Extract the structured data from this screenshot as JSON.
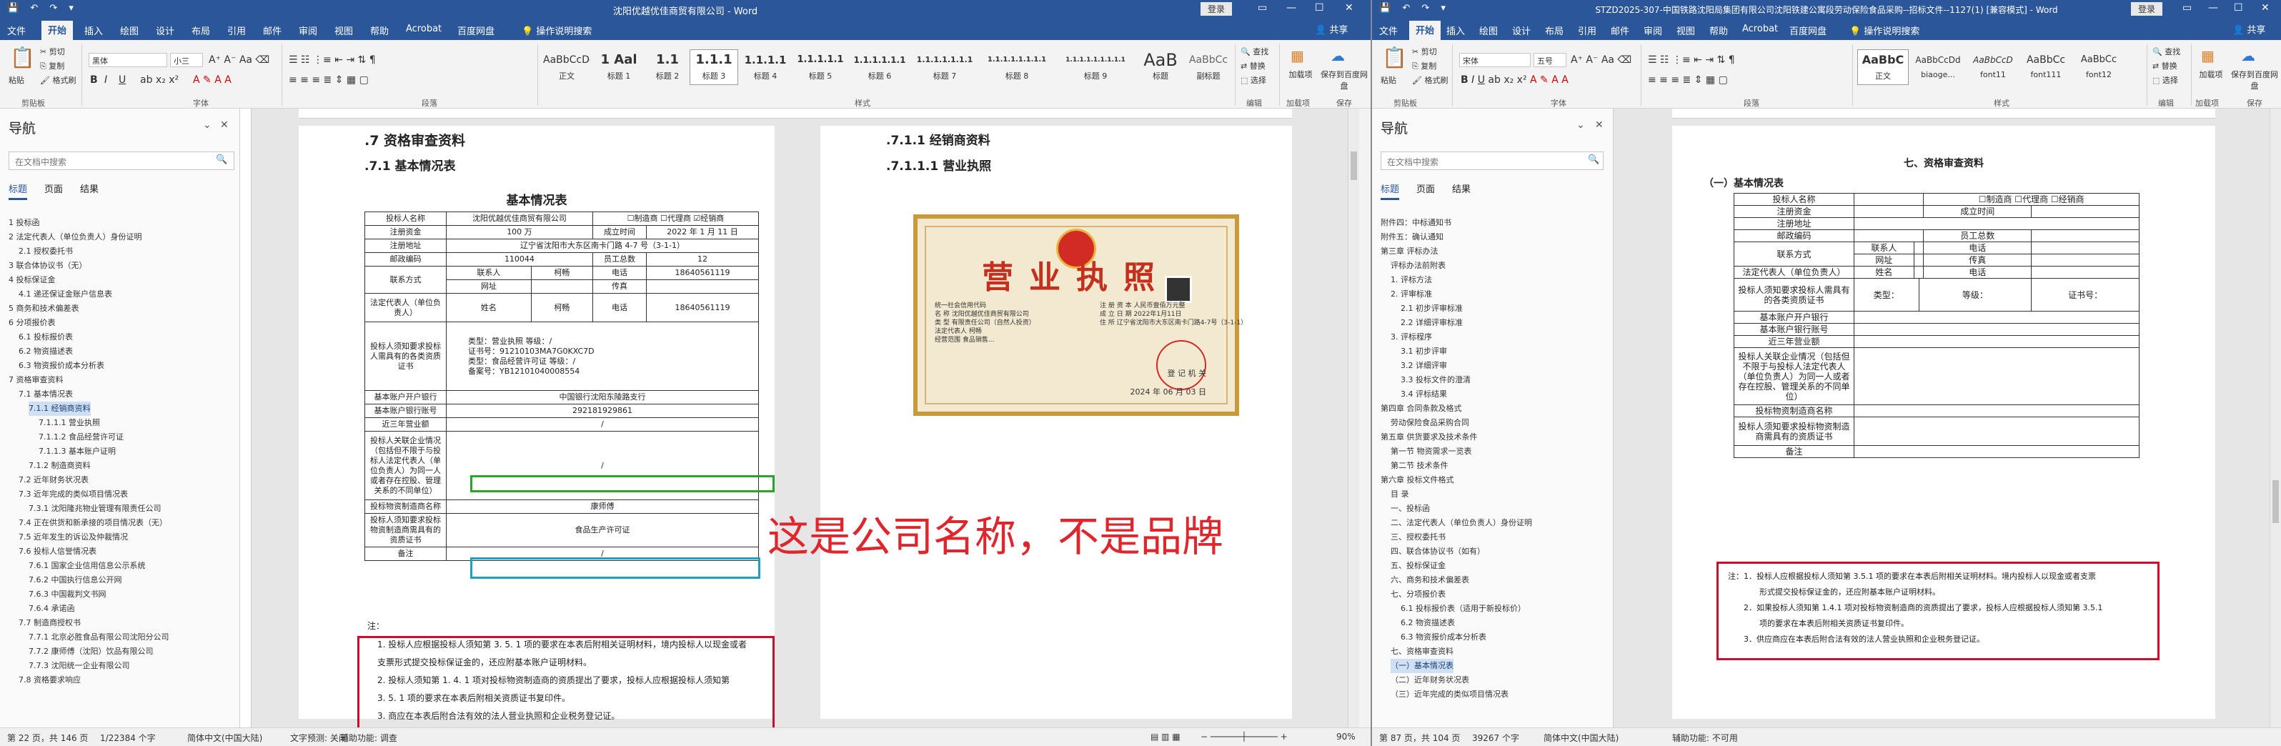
{
  "left": {
    "title": "沈阳优越优佳商贸有限公司 - Word",
    "signin": "登录",
    "share": "共享",
    "tabs": [
      "文件",
      "开始",
      "插入",
      "绘图",
      "设计",
      "布局",
      "引用",
      "邮件",
      "审阅",
      "视图",
      "帮助",
      "Acrobat",
      "百度网盘",
      "操作说明搜索"
    ],
    "ribbon": {
      "clipboard": {
        "paste": "粘贴",
        "cut": "剪切",
        "copy": "复制",
        "format": "格式刷",
        "group": "剪贴板"
      },
      "font": {
        "name": "黑体",
        "size": "小三",
        "group": "字体"
      },
      "paragraph_group": "段落",
      "styles_group": "样式",
      "styles": [
        {
          "preview": "AaBbCcDc",
          "label": "正文"
        },
        {
          "preview": "1 Aal",
          "label": "标题 1"
        },
        {
          "preview": "1.1",
          "label": "标题 2"
        },
        {
          "preview": "1.1.1",
          "label": "标题 3"
        },
        {
          "preview": "1.1.1.1",
          "label": "标题 4"
        },
        {
          "preview": "1.1.1.1.1",
          "label": "标题 5"
        },
        {
          "preview": "1.1.1.1.1.1",
          "label": "标题 6"
        },
        {
          "preview": "1.1.1.1.1.1.1",
          "label": "标题 7"
        },
        {
          "preview": "1.1.1.1.1.1.1.1",
          "label": "标题 8"
        },
        {
          "preview": "1.1.1.1.1.1.1.1.1",
          "label": "标题 9"
        },
        {
          "preview": "AaB",
          "label": "标题"
        },
        {
          "preview": "AaBbCc",
          "label": "副标题"
        }
      ],
      "editing": {
        "find": "查找",
        "replace": "替换",
        "select": "选择",
        "group": "编辑"
      },
      "addins": {
        "label": "加载项",
        "group": "加载项"
      },
      "baidu": {
        "label": "保存到百度网盘",
        "group": "保存"
      }
    },
    "nav": {
      "title": "导航",
      "search_placeholder": "在文档中搜索",
      "tabs": [
        "标题",
        "页面",
        "结果"
      ],
      "items": [
        "1 投标函",
        "2 法定代表人（单位负责人）身份证明",
        "2.1 授权委托书",
        "3 联合体协议书（无）",
        "4 投标保证金",
        "4.1 递还保证金账户信息表",
        "5 商务和技术偏差表",
        "6 分项报价表",
        "6.1 投标报价表",
        "6.2 物资描述表",
        "6.3 物资报价成本分析表",
        "7 资格审查资料",
        "7.1 基本情况表",
        "7.1.1 经销商资料",
        "7.1.1.1 营业执照",
        "7.1.1.2 食品经营许可证",
        "7.1.1.3 基本账户证明",
        "7.1.2 制造商资料",
        "7.2 近年财务状况表",
        "7.3 近年完成的类似项目情况表",
        "7.3.1 沈阳隆兆物业管理有限责任公司",
        "7.4 正在供货和新承接的项目情况表（无）",
        "7.5 近年发生的诉讼及仲裁情况",
        "7.6 投标人信誉情况表",
        "7.6.1 国家企业信用信息公示系统",
        "7.6.2 中国执行信息公开网",
        "7.6.3 中国裁判文书网",
        "7.6.4 承诺函",
        "7.7 制造商授权书",
        "7.7.1 北京必胜食品有限公司沈阳分公司",
        "7.7.2 康师傅（沈阳）饮品有限公司",
        "7.7.3 沈阳统一企业有限公司",
        "7.8 资格要求响应"
      ]
    },
    "page1": {
      "h7": ".7  资格审查资料",
      "h71": ".7.1  基本情况表",
      "table_title": "基本情况表",
      "t": {
        "name_lbl": "投标人名称",
        "name": "沈阳优越优佳商贸有限公司",
        "checks": "☐制造商  ☐代理商  ☑经销商",
        "reg_lbl": "注册资金",
        "reg": "100 万",
        "date_lbl": "成立时间",
        "date": "2022 年 1 月 11 日",
        "addr_lbl": "注册地址",
        "addr": "辽宁省沈阳市大东区南卡门路 4-7 号（3-1-1）",
        "zip_lbl": "邮政编码",
        "zip": "110044",
        "staff_lbl": "员工总数",
        "staff": "12",
        "contact_lbl": "联系方式",
        "c1": "联系人",
        "c1v": "柯畅",
        "c2": "电话",
        "c2v": "18640561119",
        "web": "网址",
        "fax": "传真",
        "legal_lbl": "法定代表人（单位负责人）",
        "ln": "姓名",
        "lnv": "柯畅",
        "lt": "电话",
        "ltv": "18640561119",
        "qual_lbl": "投标人须知要求投标人需具有的各类资质证书",
        "qual": "类型：营业执照    等级：/\n证书号：91210103MA7G0KXC7D\n类型：食品经营许可证  等级：/\n备案号：YB12101040008554",
        "bank_lbl": "基本账户开户银行",
        "bank": "中国银行沈阳东陵路支行",
        "acct_lbl": "基本账户银行账号",
        "acct": "292181929861",
        "sales_lbl": "近三年营业额",
        "related_lbl": "投标人关联企业情况（包括但不限于与投标人法定代表人（单位负责人）为同一人或者存在控股、管理关系的不同单位）",
        "brand_lbl": "投标物资制造商名称",
        "brand": "康师傅",
        "mfr_lbl": "投标人须知要求投标物资制造商需具有的资质证书",
        "mfr": "食品生产许可证",
        "remark_lbl": "备注",
        "slash": "/"
      },
      "note_head": "注：",
      "notes": [
        "1. 投标人应根据投标人须知第 3. 5. 1 项的要求在本表后附相关证明材料，境内投标人以现金或者",
        "支票形式提交投标保证金的，还应附基本账户证明材料。",
        "2. 投标人须知第 1. 4. 1 项对投标物资制造商的资质提出了要求，投标人应根据投标人须知第",
        "3. 5. 1 项的要求在本表后附相关资质证书复印件。",
        "3. 商应在本表后附合法有效的法人营业执照和企业税务登记证。"
      ]
    },
    "page2": {
      "h711": ".7.1.1  经销商资料",
      "h7111": ".7.1.1.1    营业执照",
      "license": {
        "title": "营业执照",
        "rows": [
          "统一社会信用代码",
          "名  称  沈阳优越优佳商贸有限公司",
          "类  型  有限责任公司（自然人投资）",
          "法定代表人  柯畅",
          "经营范围  食品销售..."
        ],
        "rows2": [
          "注 册 资 本  人民币壹佰万元整",
          "成 立 日 期  2022年1月11日",
          "住    所  辽宁省沈阳市大东区南卡门路4-7号（3-1-1）"
        ],
        "authority": "登 记 机 关",
        "date": "2024 年 06 月 03 日"
      }
    },
    "annotation": "这是公司名称，不是品牌",
    "status": {
      "page": "第 22 页，共 146 页",
      "words": "1/22384 个字",
      "lang": "简体中文(中国大陆)",
      "text_pred": "文字预测: 关闭",
      "access": "辅助功能: 调查",
      "zoom": "90%"
    }
  },
  "right": {
    "title": "STZD2025-307-中国铁路沈阳局集团有限公司沈阳铁建公寓段劳动保险食品采购--招标文件--1127(1) [兼容模式] - Word",
    "signin": "登录",
    "share": "共享",
    "tabs": [
      "文件",
      "开始",
      "插入",
      "绘图",
      "设计",
      "布局",
      "引用",
      "邮件",
      "审阅",
      "视图",
      "帮助",
      "Acrobat",
      "百度网盘",
      "操作说明搜索"
    ],
    "ribbon": {
      "clipboard": {
        "paste": "粘贴",
        "cut": "剪切",
        "copy": "复制",
        "format": "格式刷",
        "group": "剪贴板"
      },
      "font": {
        "name": "宋体",
        "size": "五号",
        "group": "字体"
      },
      "paragraph_group": "段落",
      "styles_group": "样式",
      "styles": [
        {
          "preview": "AaBbC",
          "label": "正文"
        },
        {
          "preview": "AaBbCcDd",
          "label": "biaoge..."
        },
        {
          "preview": "AaBbCcD",
          "label": "font11"
        },
        {
          "preview": "AaBbCc",
          "label": "font111"
        },
        {
          "preview": "AaBbCc",
          "label": "font12"
        }
      ],
      "editing": {
        "find": "查找",
        "replace": "替换",
        "select": "选择",
        "group": "编辑"
      },
      "addins": {
        "label": "加载项",
        "group": "加载项"
      },
      "baidu": {
        "label": "保存到百度网盘",
        "group": "保存"
      }
    },
    "nav": {
      "title": "导航",
      "search_placeholder": "在文档中搜索",
      "tabs": [
        "标题",
        "页面",
        "结果"
      ],
      "items": [
        "附件四：中标通知书",
        "附件五：确认通知",
        "第三章 评标办法",
        "评标办法前附表",
        "1. 评标方法",
        "2. 评审标准",
        "2.1 初步评审标准",
        "2.2 详细评审标准",
        "3. 评标程序",
        "3.1 初步评审",
        "3.2 详细评审",
        "3.3 投标文件的澄清",
        "3.4 评标结果",
        "第四章 合同条款及格式",
        "劳动保险食品采购合同",
        "第五章 供货要求及技术条件",
        "第一节 物资需求一览表",
        "第二节 技术条件",
        "第六章 投标文件格式",
        "目  录",
        "一、投标函",
        "二、法定代表人（单位负责人）身份证明",
        "三、授权委托书",
        "四、联合体协议书（如有）",
        "五、投标保证金",
        "六、商务和技术偏差表",
        "七、分项报价表",
        "6.1 投标报价表（适用于新投标价）",
        "6.2 物资描述表",
        "6.3 物资报价成本分析表",
        "七、资格审查资料",
        "（一）基本情况表",
        "（二）近年财务状况表",
        "（三）近年完成的类似项目情况表"
      ]
    },
    "page": {
      "h7": "七、资格审查资料",
      "h71": "（一）基本情况表",
      "rows": [
        [
          "投标人名称",
          "",
          "☐制造商  ☐代理商  ☐经销商"
        ],
        [
          "注册资金",
          "",
          "成立时间",
          ""
        ],
        [
          "注册地址",
          ""
        ],
        [
          "邮政编码",
          "",
          "员工总数",
          ""
        ],
        [
          "联系方式",
          "联系人",
          "电话"
        ],
        [
          "",
          "网址",
          "传真"
        ],
        [
          "法定代表人（单位负责人）",
          "姓名",
          "电话"
        ],
        [
          "投标人须知要求投标人需具有的各类资质证书",
          "类型：",
          "等级：",
          "证书号："
        ],
        [
          "基本账户开户银行",
          ""
        ],
        [
          "基本账户银行账号",
          ""
        ],
        [
          "近三年营业额",
          ""
        ],
        [
          "投标人关联企业情况（包括但不限于与投标人法定代表人（单位负责人）为同一人或者存在控股、管理关系的不同单位）",
          ""
        ],
        [
          "投标物资制造商名称",
          ""
        ],
        [
          "投标人须知要求投标物资制造商需具有的资质证书",
          ""
        ],
        [
          "备注",
          ""
        ]
      ],
      "notes": [
        "注：1．投标人应根据投标人须知第 3.5.1 项的要求在本表后附相关证明材料。境内投标人以现金或者支票",
        "形式提交投标保证金的，还应附基本账户证明材料。",
        "2．如果投标人须知第 1.4.1 项对投标物资制造商的资质提出了要求，投标人应根据投标人须知第 3.5.1",
        "项的要求在本表后附相关资质证书复印件。",
        "3．供应商应在本表后附合法有效的法人营业执照和企业税务登记证。"
      ]
    },
    "status": {
      "page": "第 87 页，共 104 页",
      "words": "39267 个字",
      "lang": "简体中文(中国大陆)",
      "access": "辅助功能: 不可用"
    }
  }
}
